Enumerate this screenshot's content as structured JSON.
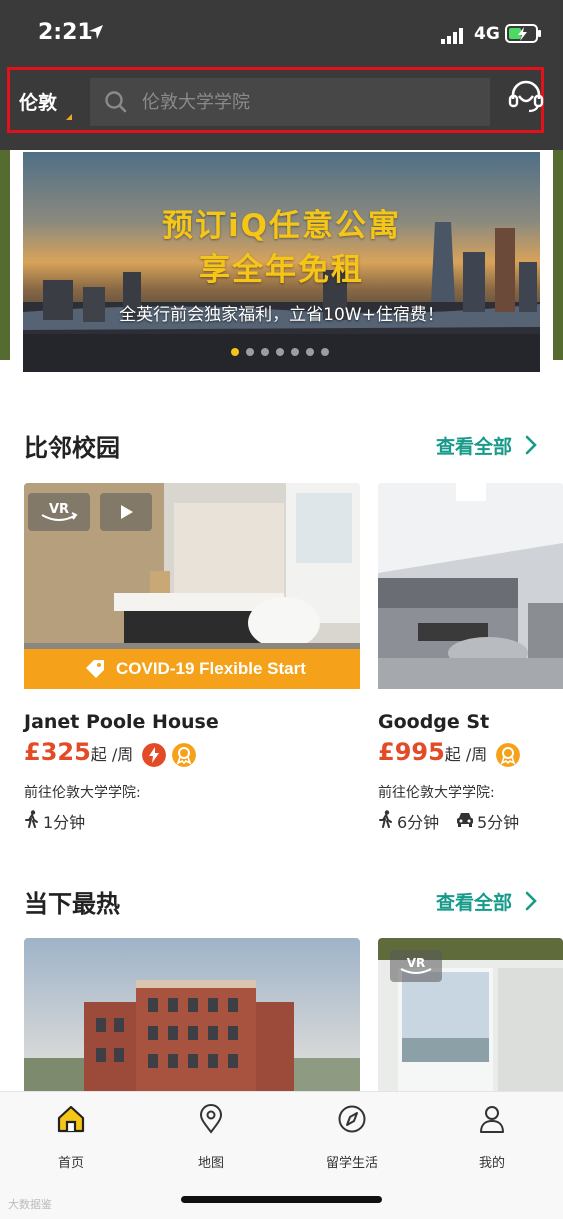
{
  "status_bar": {
    "time": "2:21",
    "network": "4G"
  },
  "header": {
    "city": "伦敦",
    "search_placeholder": "伦敦大学学院"
  },
  "banner": {
    "title_line1": "预订iQ任意公寓",
    "title_line2": "享全年免租",
    "subtitle": "全英行前会独家福利，立省10W+住宿费！",
    "slide_count": 7,
    "active_slide": 0
  },
  "section_nearby": {
    "title": "比邻校园",
    "more_label": "查看全部",
    "cards": [
      {
        "name": "Janet Poole House",
        "price": "£325",
        "price_suffix": "起 /周",
        "badge_text": "COVID-19 Flexible Start",
        "destination": "前往伦敦大学学院:",
        "walk_time": "1分钟"
      },
      {
        "name": "Goodge St",
        "price": "£995",
        "price_suffix": "起 /周",
        "destination": "前往伦敦大学学院:",
        "walk_time": "6分钟",
        "drive_time": "5分钟"
      }
    ]
  },
  "section_hot": {
    "title": "当下最热",
    "more_label": "查看全部"
  },
  "tabbar": {
    "items": [
      {
        "label": "首页",
        "icon": "home-icon",
        "active": true
      },
      {
        "label": "地图",
        "icon": "map-pin-icon",
        "active": false
      },
      {
        "label": "留学生活",
        "icon": "compass-icon",
        "active": false
      },
      {
        "label": "我的",
        "icon": "user-icon",
        "active": false
      }
    ]
  },
  "watermark": "大数据鉴",
  "colors": {
    "header_bg": "#3a3a3a",
    "accent_teal": "#169a8a",
    "price_red": "#e24b26",
    "covid_orange": "#f5a21a",
    "banner_yellow": "#f5c518",
    "highlight_red": "#e3121a"
  }
}
